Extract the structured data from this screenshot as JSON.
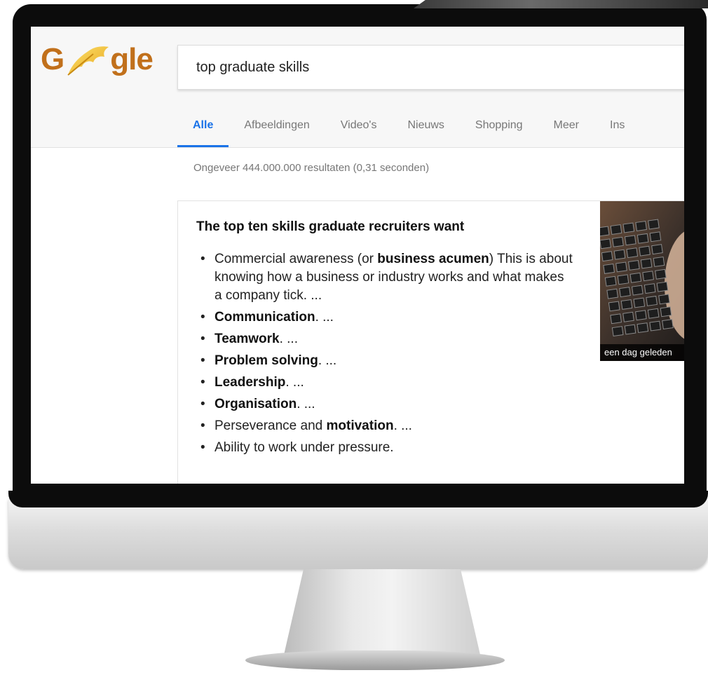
{
  "logo": {
    "prefix": "G",
    "suffix": "gle",
    "leaf_icon": "ginkgo-leaf-icon"
  },
  "search": {
    "value": "top graduate skills"
  },
  "tabs": [
    {
      "label": "Alle",
      "active": true
    },
    {
      "label": "Afbeeldingen",
      "active": false
    },
    {
      "label": "Video's",
      "active": false
    },
    {
      "label": "Nieuws",
      "active": false
    },
    {
      "label": "Shopping",
      "active": false
    },
    {
      "label": "Meer",
      "active": false
    },
    {
      "label": "Ins",
      "active": false
    }
  ],
  "result_stats": "Ongeveer 444.000.000 resultaten (0,31 seconden)",
  "snippet": {
    "title": "The top ten skills graduate recruiters want",
    "items": [
      {
        "pre": "Commercial awareness (or ",
        "bold": "business acumen",
        "post": ") This is about knowing how a business or industry works and what makes a company tick. ..."
      },
      {
        "pre": "",
        "bold": "Communication",
        "post": ". ..."
      },
      {
        "pre": "",
        "bold": "Teamwork",
        "post": ". ..."
      },
      {
        "pre": "",
        "bold": "Problem solving",
        "post": ". ..."
      },
      {
        "pre": "",
        "bold": "Leadership",
        "post": ". ..."
      },
      {
        "pre": "",
        "bold": "Organisation",
        "post": ". ..."
      },
      {
        "pre": "Perseverance and ",
        "bold": "motivation",
        "post": ". ..."
      },
      {
        "pre": "Ability to work under pressure.",
        "bold": "",
        "post": ""
      }
    ],
    "thumbnail": {
      "caption": "een dag geleden",
      "icon": "laptop-keyboard-image"
    }
  },
  "colors": {
    "accent": "#1a73e8",
    "logo": "#c1701b",
    "leaf": "#f2c230"
  }
}
